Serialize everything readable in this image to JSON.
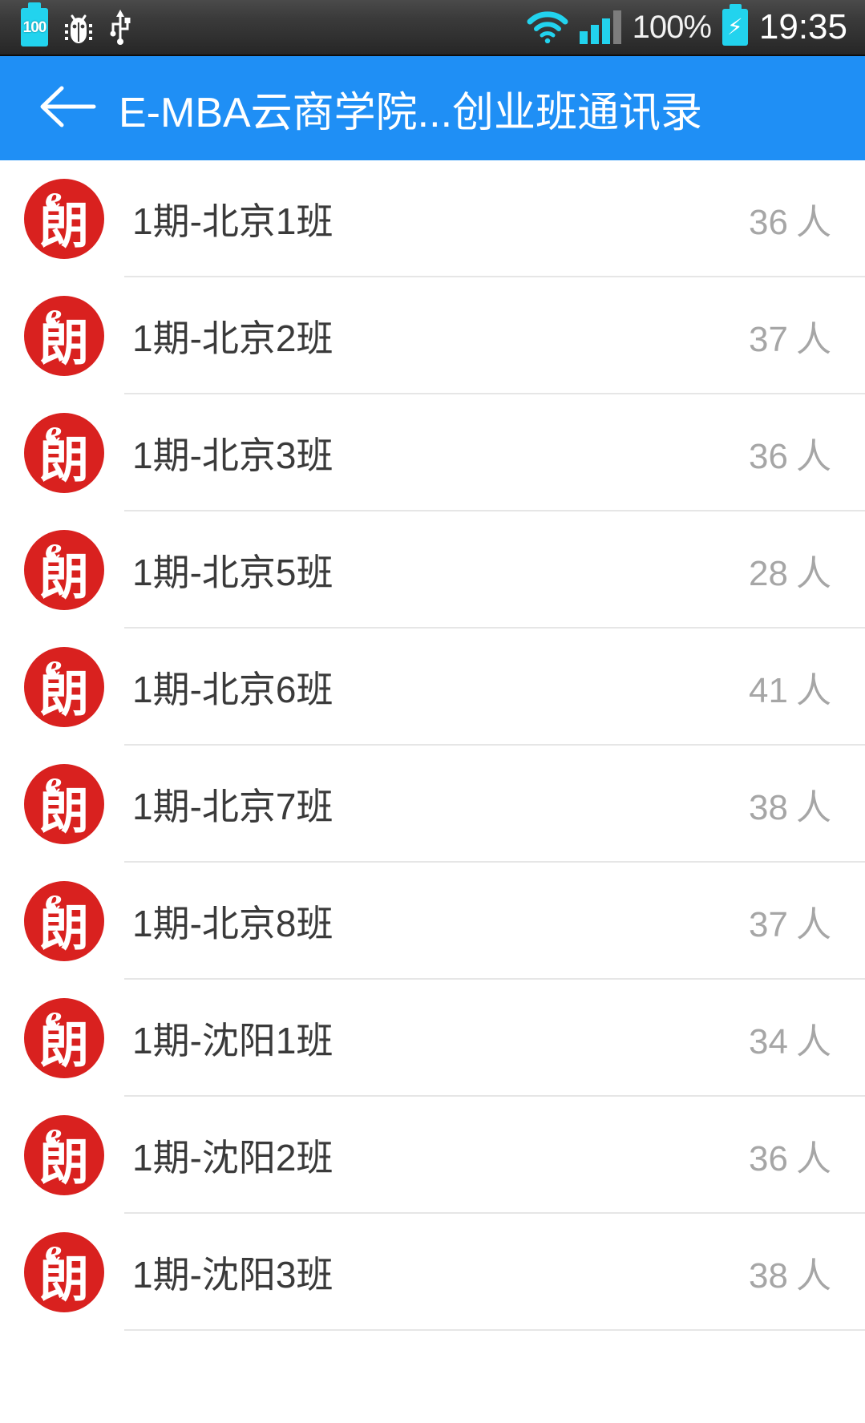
{
  "status_bar": {
    "left_icons": [
      {
        "name": "battery-level-icon",
        "label": "100"
      },
      {
        "name": "debug-bug-icon",
        "label": ""
      },
      {
        "name": "usb-icon",
        "label": ""
      }
    ],
    "wifi_icon": "wifi-icon",
    "signal_icon": "cellular-signal-icon",
    "battery_percent": "100%",
    "charging_icon": "battery-charging-icon",
    "time": "19:35"
  },
  "title_bar": {
    "back_icon": "back-arrow-icon",
    "title": "E-MBA云商学院...创业班通讯录",
    "background_color": "#1f8ff5"
  },
  "avatar": {
    "icon_name": "lang-logo-icon",
    "mark_e": "e",
    "mark_char": "朗",
    "color": "#d9211f"
  },
  "list": {
    "unit_label": "人",
    "rows": [
      {
        "name": "1期-北京1班",
        "count": "36"
      },
      {
        "name": "1期-北京2班",
        "count": "37"
      },
      {
        "name": "1期-北京3班",
        "count": "36"
      },
      {
        "name": "1期-北京5班",
        "count": "28"
      },
      {
        "name": "1期-北京6班",
        "count": "41"
      },
      {
        "name": "1期-北京7班",
        "count": "38"
      },
      {
        "name": "1期-北京8班",
        "count": "37"
      },
      {
        "name": "1期-沈阳1班",
        "count": "34"
      },
      {
        "name": "1期-沈阳2班",
        "count": "36"
      },
      {
        "name": "1期-沈阳3班",
        "count": "38"
      }
    ]
  }
}
